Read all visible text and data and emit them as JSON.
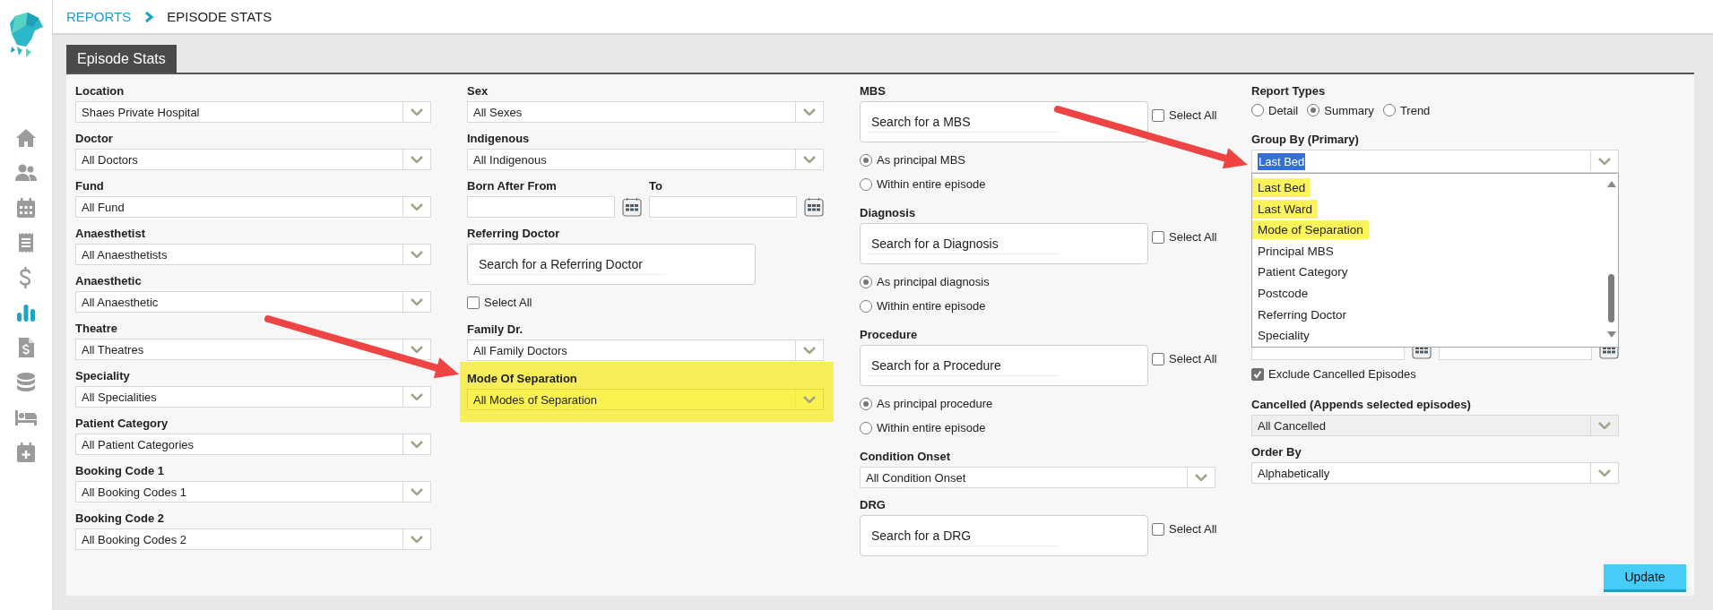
{
  "nav": [
    {
      "selected": false
    },
    {
      "selected": false
    },
    {
      "selected": false
    },
    {
      "selected": false
    },
    {
      "selected": false
    },
    {
      "selected": true
    },
    {
      "selected": false
    },
    {
      "selected": false
    },
    {
      "selected": false
    },
    {
      "selected": false
    }
  ],
  "breadcrumb": [
    {
      "text": "REPORTS",
      "kind": "link"
    },
    {
      "text": "EPISODE STATS",
      "kind": "current"
    }
  ],
  "tabs": [
    {
      "label": "Episode Stats",
      "selected": true
    }
  ],
  "columns": [
    {
      "fields": [
        {
          "kind": "select",
          "label": "Location",
          "value": "Shaes Private Hospital",
          "highlighted": false,
          "disabled": false
        },
        {
          "kind": "select",
          "label": "Doctor",
          "value": "All Doctors",
          "highlighted": false,
          "disabled": false
        },
        {
          "kind": "select",
          "label": "Fund",
          "value": "All Fund",
          "highlighted": false,
          "disabled": false
        },
        {
          "kind": "select",
          "label": "Anaesthetist",
          "value": "All Anaesthetists",
          "highlighted": false,
          "disabled": false
        },
        {
          "kind": "select",
          "label": "Anaesthetic",
          "value": "All Anaesthetic",
          "highlighted": false,
          "disabled": false
        },
        {
          "kind": "select",
          "label": "Theatre",
          "value": "All Theatres",
          "highlighted": false,
          "disabled": false
        },
        {
          "kind": "select",
          "label": "Speciality",
          "value": "All Specialities",
          "highlighted": false,
          "disabled": false
        },
        {
          "kind": "select",
          "label": "Patient Category",
          "value": "All Patient Categories",
          "highlighted": false,
          "disabled": false
        },
        {
          "kind": "select",
          "label": "Booking Code 1",
          "value": "All Booking Codes 1",
          "highlighted": false,
          "disabled": false
        },
        {
          "kind": "select",
          "label": "Booking Code 2",
          "value": "All Booking Codes 2",
          "highlighted": false,
          "disabled": false
        }
      ]
    },
    {
      "fields": [
        {
          "kind": "select",
          "label": "Sex",
          "value": "All Sexes",
          "highlighted": false,
          "disabled": false
        },
        {
          "kind": "select",
          "label": "Indigenous",
          "value": "All Indigenous",
          "highlighted": false,
          "disabled": false
        },
        {
          "kind": "dates",
          "from_label": "Born After From",
          "to_label": "To"
        },
        {
          "kind": "search",
          "label": "Referring Doctor",
          "placeholder": "Search for a Referring Doctor"
        },
        {
          "kind": "checkbox",
          "label": "Select All",
          "checked": false
        },
        {
          "kind": "select",
          "label": "Family Dr.",
          "value": "All Family Doctors",
          "highlighted": false,
          "disabled": false
        },
        {
          "kind": "select",
          "label": "Mode Of Separation",
          "value": "All Modes of Separation",
          "highlighted": true,
          "disabled": false
        }
      ]
    },
    {
      "fields": [
        {
          "kind": "search",
          "label": "MBS",
          "placeholder": "Search for a MBS",
          "select_all": {
            "label": "Select All",
            "checked": false
          },
          "options": [
            {
              "label": "As principal MBS",
              "selected": true
            },
            {
              "label": "Within entire episode",
              "selected": false
            }
          ]
        },
        {
          "kind": "search",
          "label": "Diagnosis",
          "placeholder": "Search for a Diagnosis",
          "select_all": {
            "label": "Select All",
            "checked": false
          },
          "options": [
            {
              "label": "As principal diagnosis",
              "selected": true
            },
            {
              "label": "Within entire episode",
              "selected": false
            }
          ]
        },
        {
          "kind": "search",
          "label": "Procedure",
          "placeholder": "Search for a Procedure",
          "select_all": {
            "label": "Select All",
            "checked": false
          },
          "options": [
            {
              "label": "As principal procedure",
              "selected": true
            },
            {
              "label": "Within entire episode",
              "selected": false
            }
          ]
        },
        {
          "kind": "select",
          "label": "Condition Onset",
          "value": "All Condition Onset",
          "highlighted": false,
          "disabled": false
        },
        {
          "kind": "search",
          "label": "DRG",
          "placeholder": "Search for a DRG",
          "select_all": {
            "label": "Select All",
            "checked": false
          }
        }
      ]
    },
    {
      "fields": [
        {
          "kind": "radio_row",
          "label": "Report Types",
          "options": [
            {
              "label": "Detail",
              "selected": false
            },
            {
              "label": "Summary",
              "selected": true
            },
            {
              "label": "Trend",
              "selected": false
            }
          ]
        },
        {
          "kind": "combo",
          "label": "Group By (Primary)",
          "value": "Last Bed",
          "items": [
            {
              "text": "Last Bed",
              "highlighted": true
            },
            {
              "text": "Last Ward",
              "highlighted": true
            },
            {
              "text": "Mode of Separation",
              "highlighted": true
            },
            {
              "text": "Principal MBS",
              "highlighted": false
            },
            {
              "text": "Patient Category",
              "highlighted": false
            },
            {
              "text": "Postcode",
              "highlighted": false
            },
            {
              "text": "Referring Doctor",
              "highlighted": false
            },
            {
              "text": "Speciality",
              "highlighted": false
            }
          ]
        },
        {
          "kind": "dates"
        },
        {
          "kind": "checkbox",
          "label": "Exclude Cancelled Episodes",
          "checked": true
        },
        {
          "kind": "select",
          "label": "Cancelled (Appends selected episodes)",
          "value": "All Cancelled",
          "highlighted": false,
          "disabled": true
        },
        {
          "kind": "select",
          "label": "Order By",
          "value": "Alphabetically",
          "highlighted": false,
          "disabled": false
        }
      ]
    }
  ],
  "update_button": "Update",
  "annotations": [
    {
      "kind": "arrow"
    },
    {
      "kind": "arrow"
    }
  ]
}
